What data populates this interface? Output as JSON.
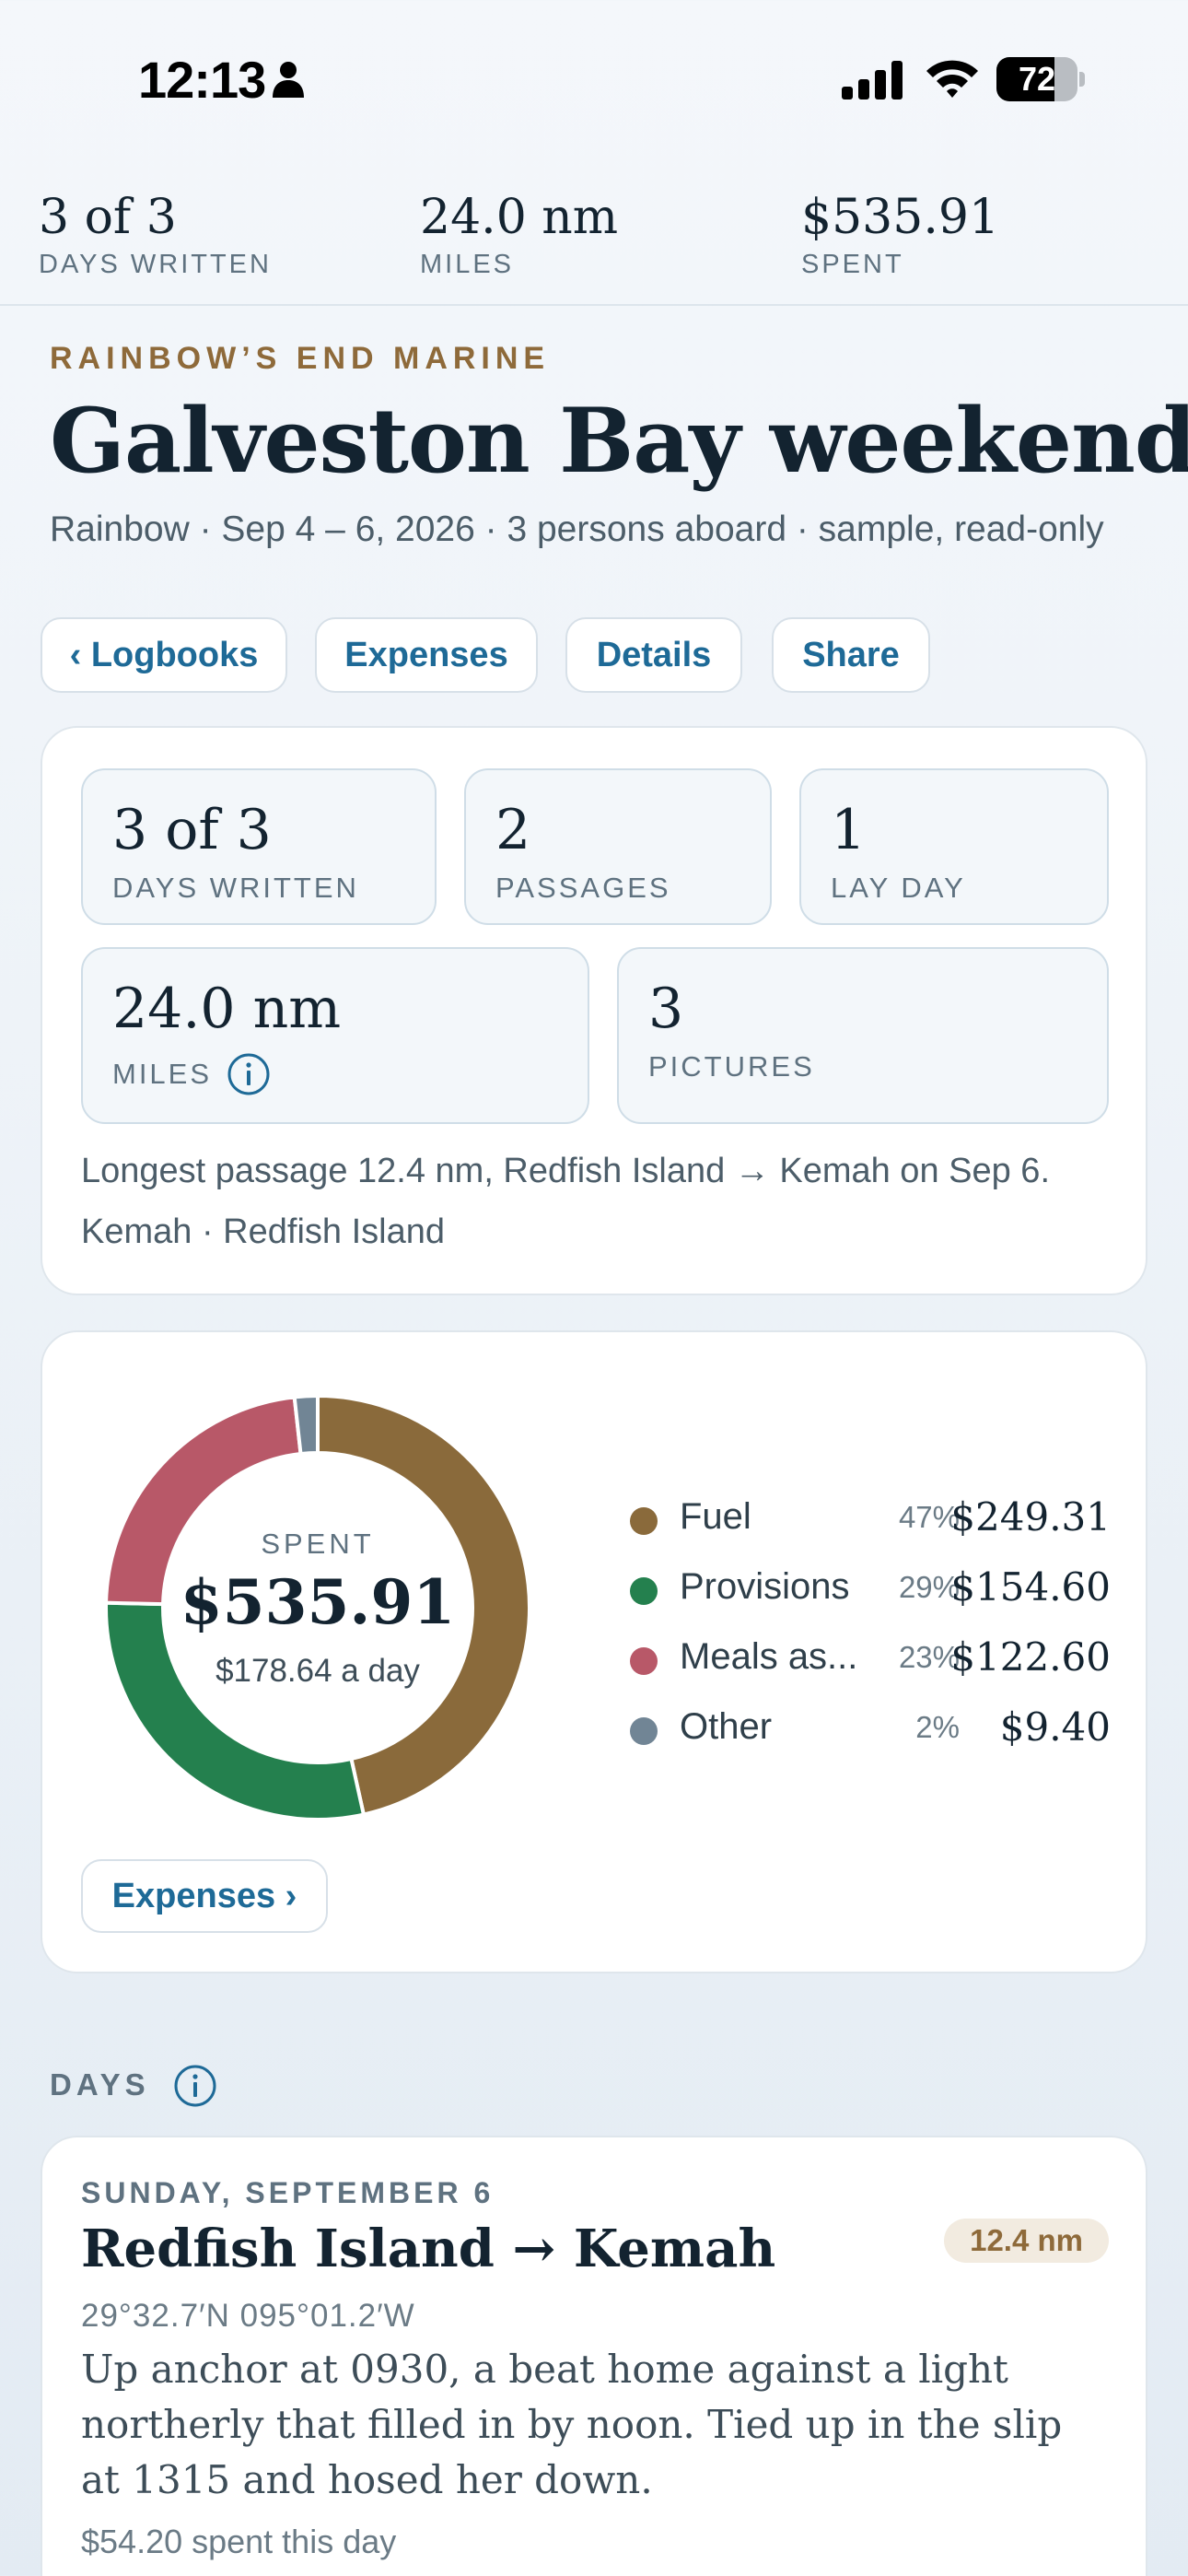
{
  "status_bar": {
    "time": "12:13",
    "battery": "72",
    "battery_level": 0.72
  },
  "summary": [
    {
      "value": "3 of 3",
      "label": "DAYS WRITTEN"
    },
    {
      "value": "24.0 nm",
      "label": "MILES"
    },
    {
      "value": "$535.91",
      "label": "SPENT"
    }
  ],
  "header": {
    "brand": "RAINBOW’S END MARINE",
    "title": "Galveston Bay weekend",
    "subtitle": "Rainbow · Sep 4 – 6, 2026 · 3 persons aboard · sample, read-only"
  },
  "nav": {
    "logbooks": "‹ Logbooks",
    "expenses": "Expenses",
    "details": "Details",
    "share": "Share"
  },
  "stats": {
    "days_written": {
      "value": "3 of 3",
      "label": "DAYS WRITTEN"
    },
    "passages": {
      "value": "2",
      "label": "PASSAGES"
    },
    "lay_day": {
      "value": "1",
      "label": "LAY DAY"
    },
    "miles": {
      "value": "24.0 nm",
      "label": "MILES"
    },
    "pictures": {
      "value": "3",
      "label": "PICTURES"
    },
    "note_longest": "Longest passage 12.4 nm, Redfish Island → Kemah on Sep 6.",
    "note_places": "Kemah · Redfish Island"
  },
  "spend": {
    "center_label": "SPENT",
    "center_value": "$535.91",
    "per_day": "$178.64 a day",
    "expenses_link": "Expenses ›"
  },
  "chart_data": {
    "type": "pie",
    "title": "",
    "categories": [
      "Fuel",
      "Provisions",
      "Meals as...",
      "Other"
    ],
    "values": [
      249.31,
      154.6,
      122.6,
      9.4
    ],
    "percent_labels": [
      "47%",
      "29%",
      "23%",
      "2%"
    ],
    "amount_labels": [
      "$249.31",
      "$154.60",
      "$122.60",
      "$9.40"
    ],
    "colors": [
      "#8a6a3b",
      "#24804e",
      "#b85868",
      "#718595"
    ],
    "legend_placement": "right"
  },
  "days_section": {
    "label": "DAYS"
  },
  "day": {
    "date": "SUNDAY, SEPTEMBER 6",
    "title": "Redfish Island → Kemah",
    "distance": "12.4 nm",
    "coords": "29°32.7′N 095°01.2′W",
    "body": "Up anchor at 0930, a beat home against a light northerly that filled in by noon. Tied up in the slip at 1315 and hosed her down.",
    "spent": "$54.20 spent this day"
  }
}
